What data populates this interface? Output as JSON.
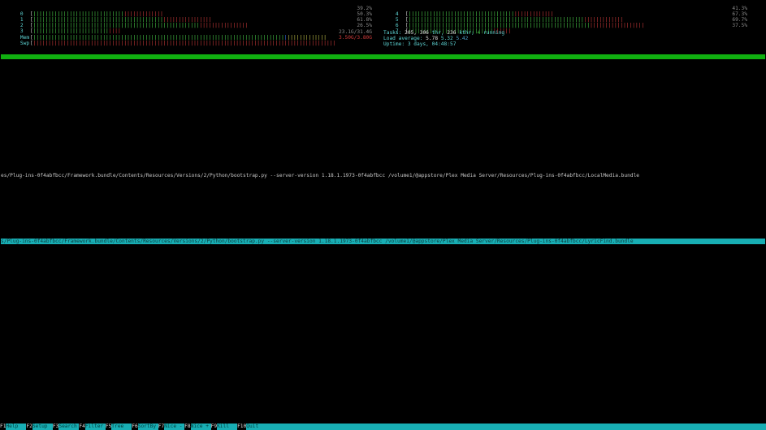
{
  "cpus_left": [
    {
      "index": "0",
      "percent": "39.2%",
      "bars": {
        "blue": 0,
        "green": 30,
        "red": 13
      }
    },
    {
      "index": "1",
      "percent": "50.3%",
      "bars": {
        "blue": 0,
        "green": 43,
        "red": 16
      }
    },
    {
      "index": "2",
      "percent": "61.8%",
      "bars": {
        "blue": 0,
        "green": 55,
        "red": 16
      }
    },
    {
      "index": "3",
      "percent": "26.5%",
      "bars": {
        "blue": 0,
        "green": 25,
        "red": 4
      }
    }
  ],
  "cpus_right": [
    {
      "index": "4",
      "percent": "41.3%",
      "bars": {
        "blue": 0,
        "green": 35,
        "red": 13
      }
    },
    {
      "index": "5",
      "percent": "67.3%",
      "bars": {
        "blue": 0,
        "green": 58,
        "red": 13
      }
    },
    {
      "index": "6",
      "percent": "69.7%",
      "bars": {
        "blue": 0,
        "green": 60,
        "red": 18
      }
    },
    {
      "index": "7",
      "percent": "37.5%",
      "bars": {
        "blue": 0,
        "green": 28,
        "red": 6
      }
    }
  ],
  "mem": {
    "label": "Mem",
    "value": "23.1G/31.4G",
    "bars": {
      "green": 83,
      "blue": 1,
      "yellow": 13
    }
  },
  "swp": {
    "label": "Swp",
    "value": "3.50G/3.80G",
    "bars": {
      "red": 100
    }
  },
  "tasks": {
    "label": "Tasks:",
    "count": "205,",
    "thr": "306",
    "thr_label": "thr,",
    "kthr": "236",
    "kthr_label": "kthr;",
    "running": "4",
    "running_label": "running"
  },
  "load": {
    "label": "Load average:",
    "l1": "5.78",
    "l5": "5.32",
    "l15": "5.42"
  },
  "uptime": {
    "label": "Uptime:",
    "value": "3 days, 04:48:57"
  },
  "process_lines": [
    "es/Plug-ins-0f4abfbcc/Framework.bundle/Contents/Resources/Versions/2/Python/bootstrap.py --server-version 1.18.1.1973-0f4abfbcc /volume1/@appstore/Plex Media Server/Resources/Plug-ins-0f4abfbcc/LocalMedia.bundle"
  ],
  "selected_line": "s/Plug-ins-0f4abfbcc/Framework.bundle/Contents/Resources/Versions/2/Python/bootstrap.py --server-version 1.18.1.1973-0f4abfbcc /volume1/@appstore/Plex Media Server/Resources/Plug-ins-0f4abfbcc/LyricFind.bundle",
  "footer": [
    {
      "key": "F1",
      "label": "Help"
    },
    {
      "key": "F2",
      "label": "Setup"
    },
    {
      "key": "F3",
      "label": "Search"
    },
    {
      "key": "F4",
      "label": "Filter"
    },
    {
      "key": "F5",
      "label": "Tree"
    },
    {
      "key": "F6",
      "label": "SortBy"
    },
    {
      "key": "F7",
      "label": "Nice -"
    },
    {
      "key": "F8",
      "label": "Nice +"
    },
    {
      "key": "F9",
      "label": "Kill"
    },
    {
      "key": "F10",
      "label": "Quit"
    }
  ]
}
